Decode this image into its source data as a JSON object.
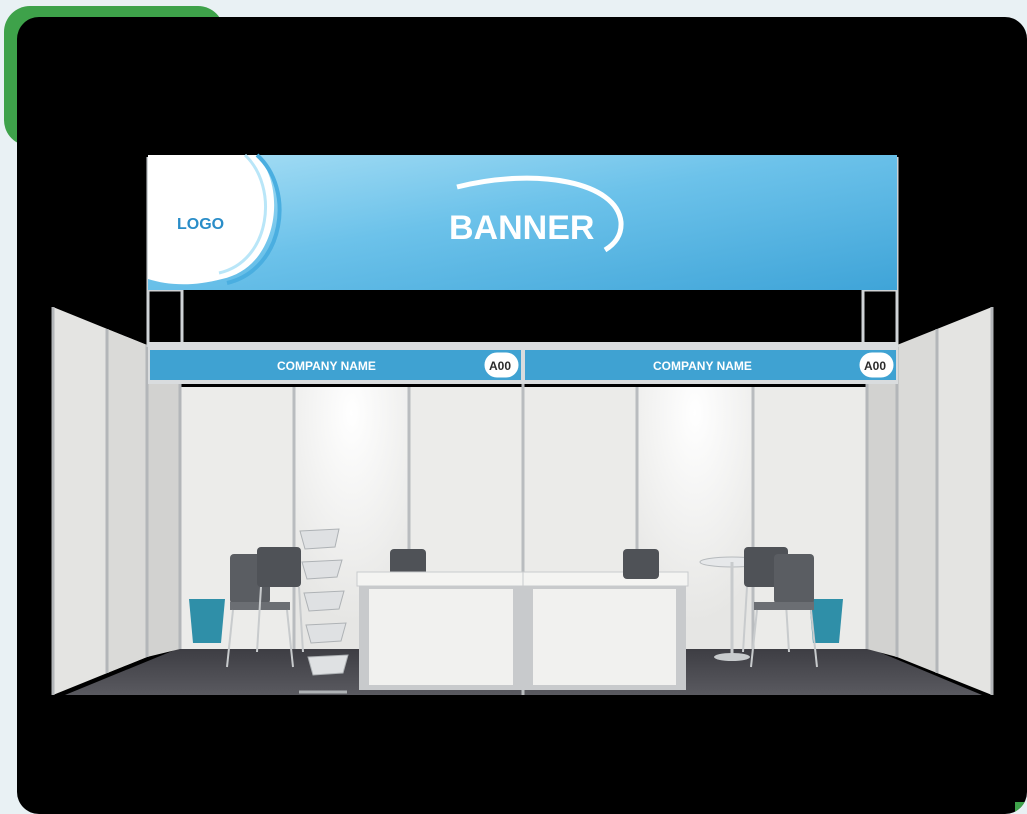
{
  "banner": {
    "logo_text": "LOGO",
    "title": "BANNER"
  },
  "fascia": [
    {
      "company": "COMPANY NAME",
      "booth": "A00"
    },
    {
      "company": "COMPANY NAME",
      "booth": "A00"
    }
  ],
  "colors": {
    "accent_green": "#3ea24a",
    "fascia_blue": "#3fa2d2",
    "banner_blue": "#59b6e3",
    "logo_blue": "#2a8dc8",
    "frame_bg": "#000000"
  }
}
